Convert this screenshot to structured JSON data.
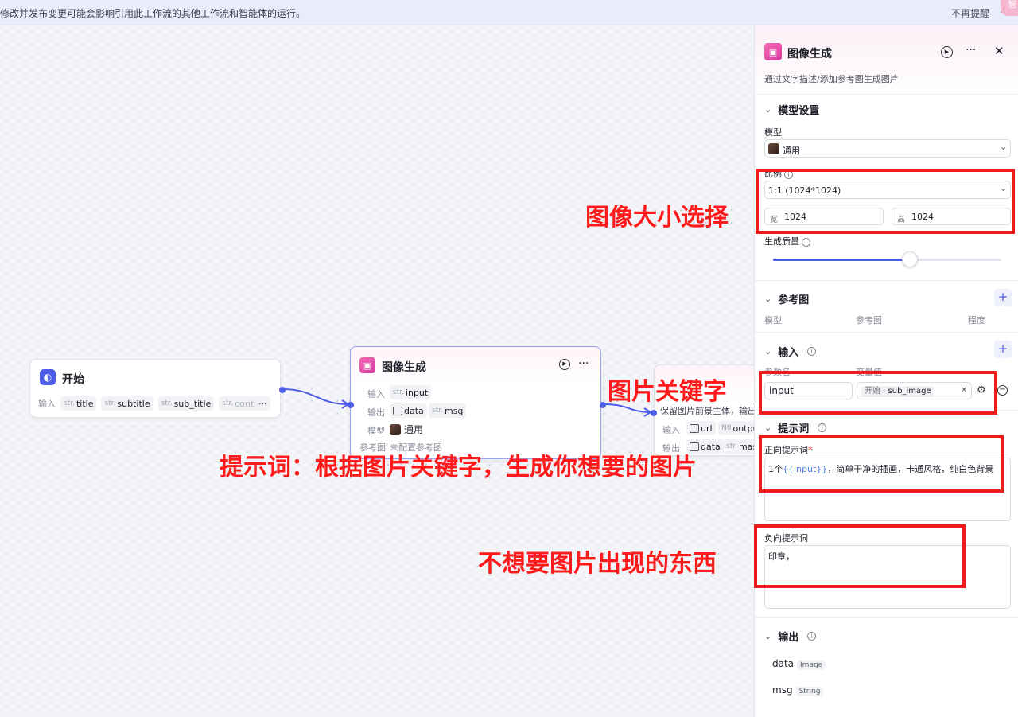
{
  "banner": {
    "text": "修改并发布变更可能会影响引用此工作流的其他工作流和智能体的运行。",
    "dismiss": "不再提醒",
    "badge": "智"
  },
  "start_node": {
    "title": "开始",
    "input_label": "输入",
    "inputs": [
      {
        "type": "str.",
        "name": "title"
      },
      {
        "type": "str.",
        "name": "subtitle"
      },
      {
        "type": "str.",
        "name": "sub_title"
      },
      {
        "type": "str.",
        "name": "conte"
      }
    ],
    "more": "···"
  },
  "image_node": {
    "title": "图像生成",
    "input_label": "输入",
    "input_chip": {
      "type": "str.",
      "name": "input"
    },
    "output_label": "输出",
    "output_chips": [
      {
        "type": "image",
        "name": "data"
      },
      {
        "type": "str.",
        "name": "msg"
      }
    ],
    "model_label": "模型",
    "model_value": "通用",
    "ref_label": "参考图",
    "ref_value": "未配置参考图",
    "more": "···"
  },
  "third_node": {
    "desc": "保留图片前景主体，输出透",
    "input_label": "输入",
    "input_chips": [
      {
        "type": "image",
        "name": "url"
      },
      {
        "type": "N0",
        "name": "outpu"
      }
    ],
    "output_label": "输出",
    "output_chips": [
      {
        "type": "image",
        "name": "data"
      },
      {
        "type": "str.",
        "name": "mask"
      }
    ]
  },
  "panel": {
    "title": "图像生成",
    "subtitle": "通过文字描述/添加参考图生成图片",
    "model_section": {
      "title": "模型设置",
      "model_label": "模型",
      "model_value": "通用",
      "ratio_label": "比例",
      "ratio_value": "1:1 (1024*1024)",
      "width_label": "宽",
      "width_value": "1024",
      "height_label": "高",
      "height_value": "1024",
      "quality_label": "生成质量",
      "quality_fraction": 0.6
    },
    "ref_section": {
      "title": "参考图",
      "columns": [
        "模型",
        "参考图",
        "程度"
      ]
    },
    "input_section": {
      "title": "输入",
      "columns": [
        "参数名",
        "变量值"
      ],
      "param_name": "input",
      "var_source": "开始",
      "var_name": "sub_image"
    },
    "prompt_section": {
      "title": "提示词",
      "positive_label": "正向提示词",
      "positive_prefix": "1个",
      "positive_var": "{{input}}",
      "positive_suffix": "，简单干净的插画，卡通风格，纯白色背景",
      "negative_label": "负向提示词",
      "negative_value": "印章，"
    },
    "output_section": {
      "title": "输出",
      "items": [
        {
          "name": "data",
          "type": "Image"
        },
        {
          "name": "msg",
          "type": "String"
        }
      ]
    }
  },
  "annotations": {
    "size": "图像大小选择",
    "keyword": "图片关键字",
    "prompt": "提示词：根据图片关键字，生成你想要的图片",
    "negative": "不想要图片出现的东西"
  },
  "colors": {
    "accent": "#4e5de8",
    "annotation_red": "#ee1c1c"
  }
}
